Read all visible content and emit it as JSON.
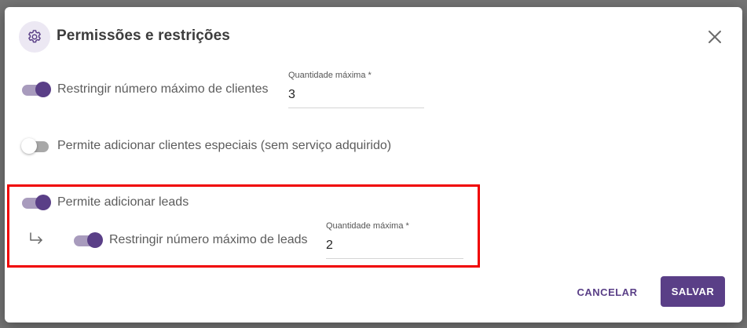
{
  "dialog": {
    "title": "Permissões e restrições",
    "icon": "gear-icon",
    "close_icon": "close-icon"
  },
  "rows": [
    {
      "label": "Restringir número máximo de clientes",
      "enabled": true,
      "field": {
        "label": "Quantidade máxima *",
        "value": "3"
      }
    },
    {
      "label": "Permite adicionar clientes especiais (sem serviço adquirido)",
      "enabled": false
    },
    {
      "label": "Permite adicionar leads",
      "enabled": true,
      "sub": {
        "icon": "subdirectory-arrow-icon",
        "label": "Restringir número máximo de leads",
        "enabled": true,
        "field": {
          "label": "Quantidade máxima *",
          "value": "2"
        }
      }
    }
  ],
  "actions": {
    "cancel_label": "CANCELAR",
    "save_label": "SALVAR"
  },
  "colors": {
    "accent": "#5a3f87",
    "accent_track": "#a89bbd",
    "highlight": "#f00000"
  }
}
